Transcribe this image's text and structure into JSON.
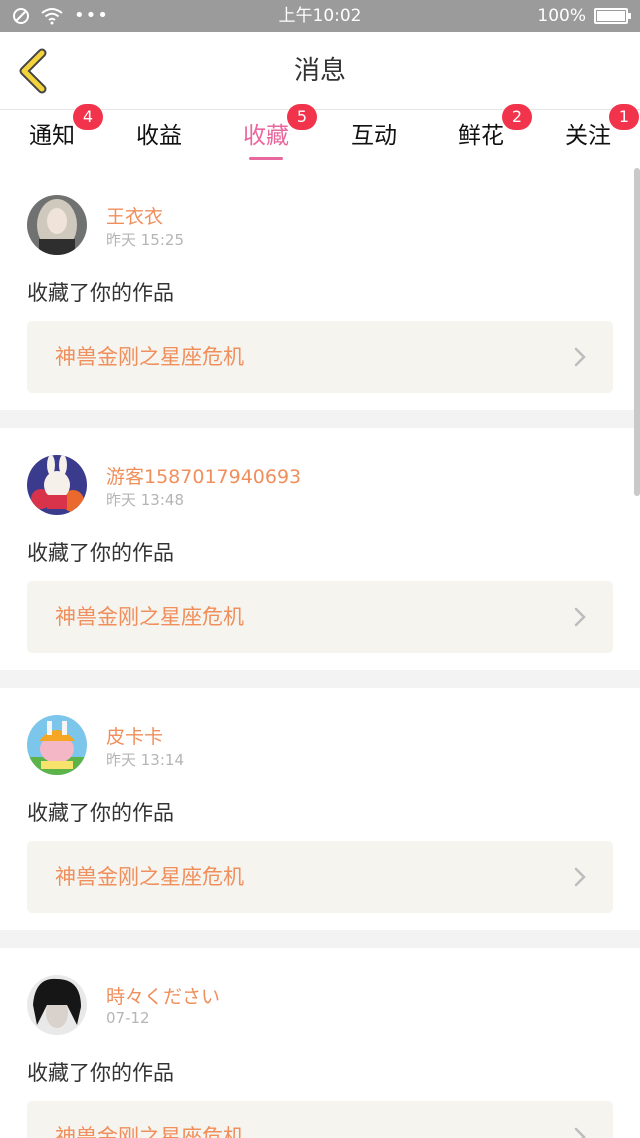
{
  "status_bar": {
    "time": "上午10:02",
    "battery": "100%",
    "more": "•••",
    "battery_level": 1.0
  },
  "header": {
    "title": "消息"
  },
  "tabs": [
    {
      "label": "通知",
      "badge": "4"
    },
    {
      "label": "收益",
      "badge": ""
    },
    {
      "label": "收藏",
      "badge": "5",
      "active": true
    },
    {
      "label": "互动",
      "badge": ""
    },
    {
      "label": "鲜花",
      "badge": "2"
    },
    {
      "label": "关注",
      "badge": "1"
    }
  ],
  "messages": [
    {
      "user": "王衣衣",
      "time": "昨天 15:25",
      "action": "收藏了你的作品",
      "work_title": "神兽金刚之星座危机"
    },
    {
      "user": "游客15870179406​93",
      "time": "昨天 13:48",
      "action": "收藏了你的作品",
      "work_title": "神兽金刚之星座危机"
    },
    {
      "user": "皮卡卡",
      "time": "昨天 13:14",
      "action": "收藏了你的作品",
      "work_title": "神兽金刚之星座危机"
    },
    {
      "user": "時々ください",
      "time": "07-12",
      "action": "收藏了你的作品",
      "work_title": "神兽金刚之星座危机"
    }
  ],
  "colors": {
    "accent": "#e8679c",
    "badge": "#f1344b",
    "name": "#f08f5c",
    "back_icon": "#f2d33b"
  }
}
